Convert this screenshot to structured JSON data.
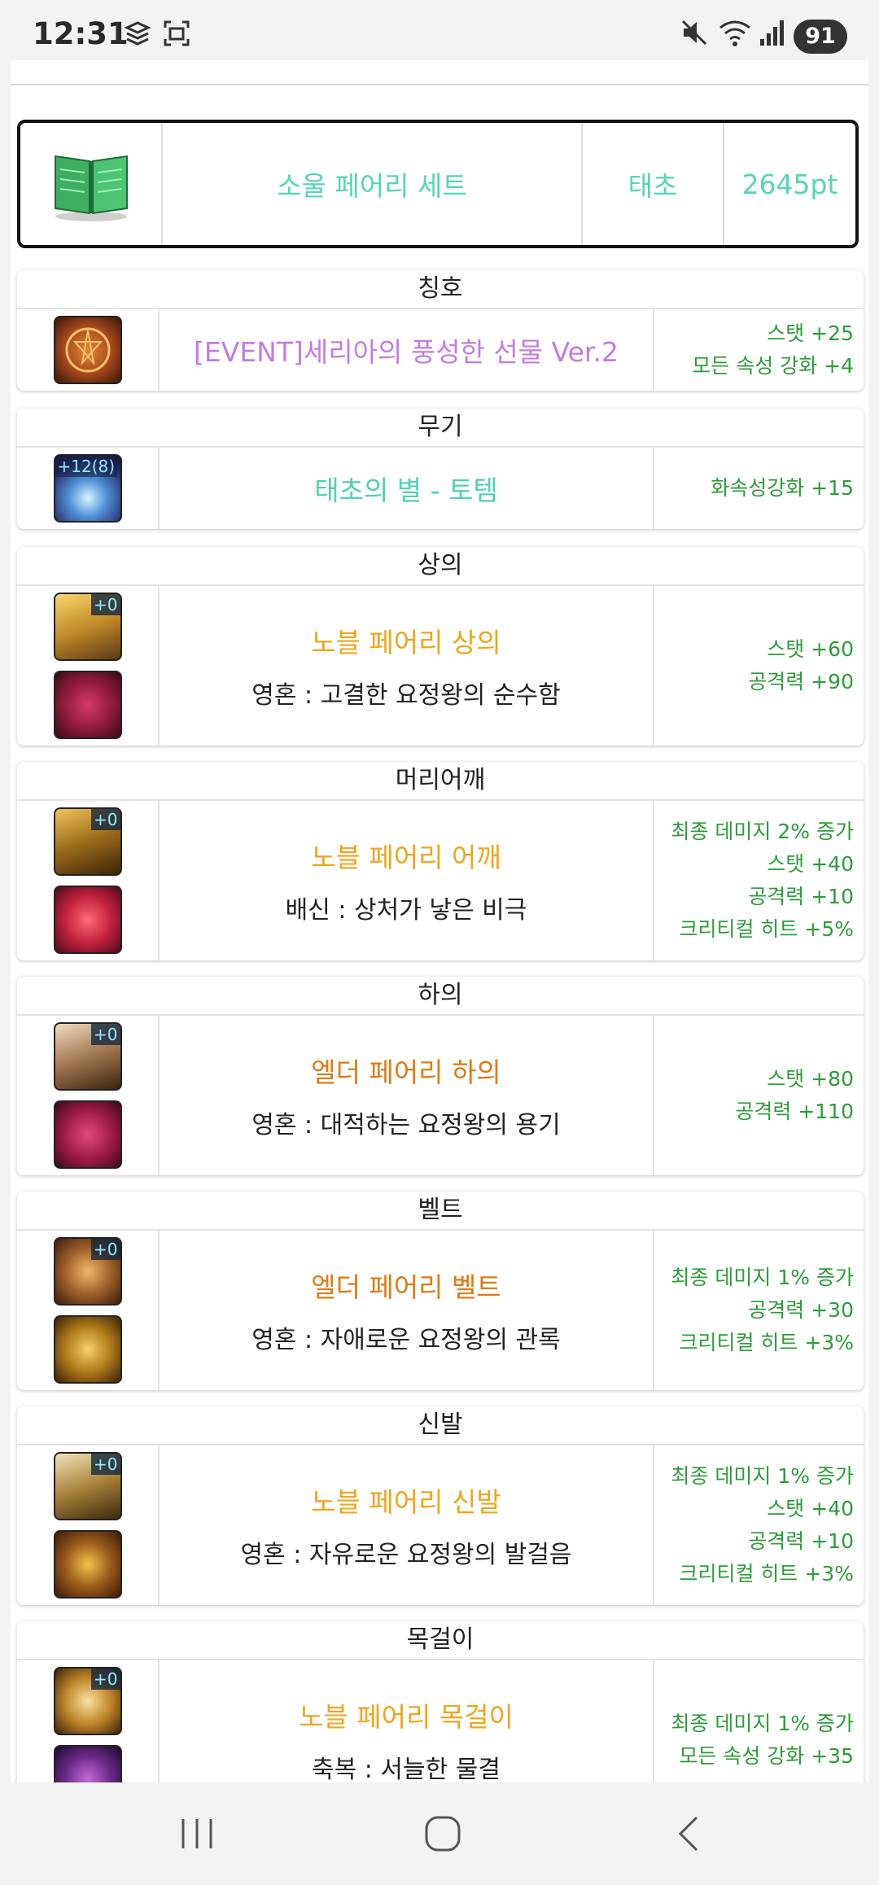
{
  "status_bar": {
    "time": "12:31",
    "battery": "91"
  },
  "set": {
    "name": "소울 페어리 세트",
    "grade": "태초",
    "points": "2645pt"
  },
  "sections": [
    {
      "title": "칭호",
      "name": "[EVENT]세리아의 풍성한 선물 Ver.2",
      "sub": "",
      "stats": [
        "스탯 +25",
        "모든 속성 강화 +4"
      ],
      "icon1_badge": "",
      "icon2_badge": ""
    },
    {
      "title": "무기",
      "name": "태초의 별 - 토템",
      "sub": "",
      "stats": [
        "화속성강화 +15"
      ],
      "icon1_badge": "+12(8)",
      "icon2_badge": ""
    },
    {
      "title": "상의",
      "name": "노블 페어리 상의",
      "sub": "영혼 : 고결한 요정왕의 순수함",
      "stats": [
        "스탯 +60",
        "공격력 +90"
      ],
      "icon1_badge": "+0",
      "icon2_badge": ""
    },
    {
      "title": "머리어깨",
      "name": "노블 페어리 어깨",
      "sub": "배신 : 상처가 낳은 비극",
      "stats": [
        "최종 데미지 2% 증가",
        "스탯 +40",
        "공격력 +10",
        "크리티컬 히트 +5%"
      ],
      "icon1_badge": "+0",
      "icon2_badge": ""
    },
    {
      "title": "하의",
      "name": "엘더 페어리 하의",
      "sub": "영혼 : 대적하는 요정왕의 용기",
      "stats": [
        "스탯 +80",
        "공격력 +110"
      ],
      "icon1_badge": "+0",
      "icon2_badge": ""
    },
    {
      "title": "벨트",
      "name": "엘더 페어리 벨트",
      "sub": "영혼 : 자애로운 요정왕의 관록",
      "stats": [
        "최종 데미지 1% 증가",
        "공격력 +30",
        "크리티컬 히트 +3%"
      ],
      "icon1_badge": "+0",
      "icon2_badge": ""
    },
    {
      "title": "신발",
      "name": "노블 페어리 신발",
      "sub": "영혼 : 자유로운 요정왕의 발걸음",
      "stats": [
        "최종 데미지 1% 증가",
        "스탯 +40",
        "공격력 +10",
        "크리티컬 히트 +3%"
      ],
      "icon1_badge": "+0",
      "icon2_badge": ""
    },
    {
      "title": "목걸이",
      "name": "노블 페어리 목걸이",
      "sub": "축복 : 서늘한 물결",
      "stats": [
        "최종 데미지 1% 증가",
        "모든 속성 강화 +35"
      ],
      "icon1_badge": "+0",
      "icon2_badge": ""
    }
  ]
}
